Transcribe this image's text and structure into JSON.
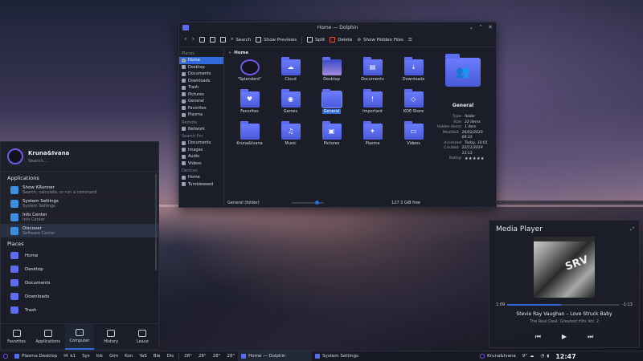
{
  "dolphin": {
    "title": "Home — Dolphin",
    "toolbar": {
      "search": "Search",
      "show_previews": "Show Previews",
      "split": "Split",
      "delete": "Delete",
      "show_hidden": "Show Hidden Files"
    },
    "sidebar": {
      "places_header": "Places",
      "places": [
        "Home",
        "Desktop",
        "Documents",
        "Downloads",
        "Trash",
        "Pictures",
        "General",
        "Favorites",
        "Plasma"
      ],
      "remote_header": "Remote",
      "remote": [
        "Network"
      ],
      "search_header": "Search For",
      "search": [
        "Documents",
        "Images",
        "Audio",
        "Videos"
      ],
      "devices_header": "Devices",
      "devices": [
        "Home",
        "Tumbleweed"
      ]
    },
    "breadcrumb": "Home",
    "items": [
      {
        "label": "\"Splendent\""
      },
      {
        "label": "Cloud",
        "glyph": "☁"
      },
      {
        "label": "Desktop"
      },
      {
        "label": "Documents",
        "glyph": "▤"
      },
      {
        "label": "Downloads",
        "glyph": "⤓"
      },
      {
        "label": "Favorites",
        "glyph": "♥"
      },
      {
        "label": "Games",
        "glyph": "◉"
      },
      {
        "label": "General"
      },
      {
        "label": "Important",
        "glyph": "!"
      },
      {
        "label": "KDE-Store",
        "glyph": "◇"
      },
      {
        "label": "Kruna&Ivana",
        "glyph": ""
      },
      {
        "label": "Music",
        "glyph": "♫"
      },
      {
        "label": "Pictures",
        "glyph": "▣"
      },
      {
        "label": "Plasma",
        "glyph": "✦"
      },
      {
        "label": "Videos",
        "glyph": "▭"
      }
    ],
    "info": {
      "name": "General",
      "type_k": "Type:",
      "type_v": "folder",
      "size_k": "Size:",
      "size_v": "22 items",
      "hidden_k": "Hidden items:",
      "hidden_v": "1 item",
      "modified_k": "Modified:",
      "modified_v": "26/02/2020 09:33",
      "accessed_k": "Accessed:",
      "accessed_v": "Today, 10:01",
      "created_k": "Created:",
      "created_v": "22/11/2019 13:13",
      "rating_k": "Rating:",
      "rating_v": "★★★★★"
    },
    "status": {
      "selection": "General (folder)",
      "free": "127.3 GiB free",
      "zoom_level": 0.72
    }
  },
  "launcher": {
    "user": "Kruna&Ivana",
    "search_placeholder": "Search...",
    "apps_header": "Applications",
    "apps": [
      {
        "title": "Show KRunner",
        "subtitle": "Search, calculate, or run a command"
      },
      {
        "title": "System Settings",
        "subtitle": "System Settings"
      },
      {
        "title": "Info Center",
        "subtitle": "Info Center"
      },
      {
        "title": "Discover",
        "subtitle": "Software Center"
      }
    ],
    "places_header": "Places",
    "places": [
      "Home",
      "Desktop",
      "Documents",
      "Downloads",
      "Trash"
    ],
    "tabs": [
      "Favorites",
      "Applications",
      "Computer",
      "History",
      "Leave"
    ]
  },
  "media": {
    "title": "Media Player",
    "elapsed": "1:09",
    "remaining": "-1:13",
    "progress": 0.48,
    "song": "Stevie Ray Vaughan – Love Struck Baby",
    "album": "The Real Deal: Greatest Hits Vol. 2",
    "art_text": "SRV",
    "controls": {
      "prev": "⏮",
      "play": "▶",
      "next": "⏭"
    }
  },
  "taskbar": {
    "desktop": "Plasma Desktop",
    "workspace1": "I4",
    "workspace2": "k1",
    "mini_apps": [
      "Sys",
      "Ink",
      "Gim",
      "Kon",
      "YaS",
      "Ble",
      "Dis"
    ],
    "temps": [
      "28°",
      "28°",
      "28°",
      "28°"
    ],
    "task_dolphin": "Home — Dolphin",
    "task_settings": "System Settings",
    "user": "Kruna&Ivana",
    "weather": "9°",
    "clock": "12:47"
  },
  "colors": {
    "accent": "#2f6ad8",
    "folder": "#5b6cf0",
    "panel": "#1b1e28"
  }
}
